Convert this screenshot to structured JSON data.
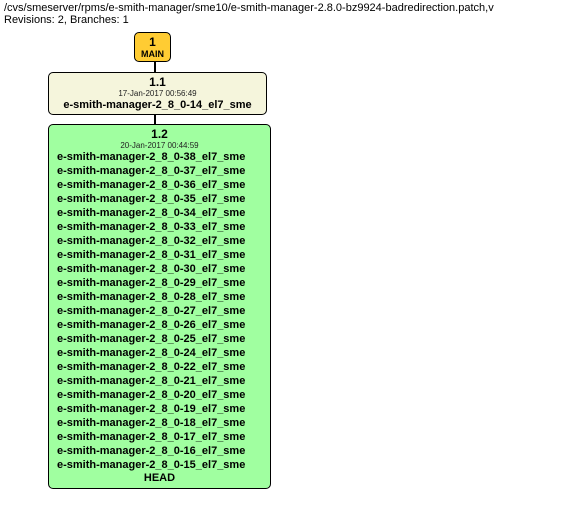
{
  "header": {
    "path": "/cvs/smeserver/rpms/e-smith-manager/sme10/e-smith-manager-2.8.0-bz9924-badredirection.patch,v",
    "stats": "Revisions: 2, Branches: 1"
  },
  "nodes": {
    "main": {
      "label": "1",
      "branch": "MAIN"
    },
    "rev11": {
      "version": "1.1",
      "date": "17-Jan-2017 00:56:49",
      "tags": [
        "e-smith-manager-2_8_0-14_el7_sme"
      ]
    },
    "rev12": {
      "version": "1.2",
      "date": "20-Jan-2017 00:44:59",
      "tags": [
        "e-smith-manager-2_8_0-38_el7_sme",
        "e-smith-manager-2_8_0-37_el7_sme",
        "e-smith-manager-2_8_0-36_el7_sme",
        "e-smith-manager-2_8_0-35_el7_sme",
        "e-smith-manager-2_8_0-34_el7_sme",
        "e-smith-manager-2_8_0-33_el7_sme",
        "e-smith-manager-2_8_0-32_el7_sme",
        "e-smith-manager-2_8_0-31_el7_sme",
        "e-smith-manager-2_8_0-30_el7_sme",
        "e-smith-manager-2_8_0-29_el7_sme",
        "e-smith-manager-2_8_0-28_el7_sme",
        "e-smith-manager-2_8_0-27_el7_sme",
        "e-smith-manager-2_8_0-26_el7_sme",
        "e-smith-manager-2_8_0-25_el7_sme",
        "e-smith-manager-2_8_0-24_el7_sme",
        "e-smith-manager-2_8_0-22_el7_sme",
        "e-smith-manager-2_8_0-21_el7_sme",
        "e-smith-manager-2_8_0-20_el7_sme",
        "e-smith-manager-2_8_0-19_el7_sme",
        "e-smith-manager-2_8_0-18_el7_sme",
        "e-smith-manager-2_8_0-17_el7_sme",
        "e-smith-manager-2_8_0-16_el7_sme",
        "e-smith-manager-2_8_0-15_el7_sme"
      ],
      "head": "HEAD"
    }
  }
}
